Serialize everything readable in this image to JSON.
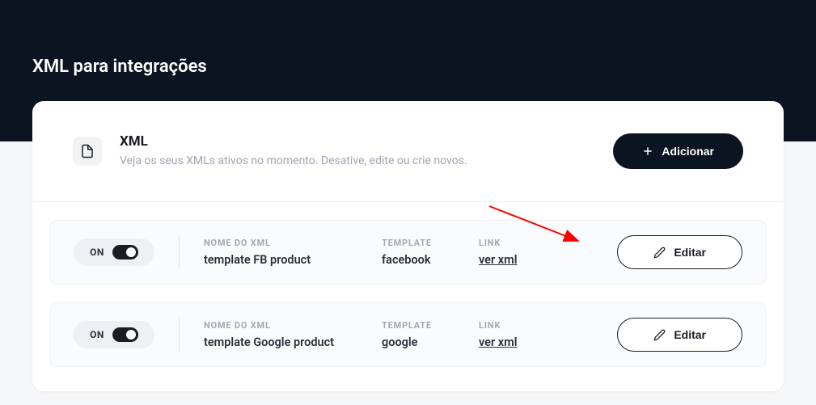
{
  "pageTitle": "XML para integrações",
  "section": {
    "title": "XML",
    "subtitle": "Veja os seus XMLs ativos no momento. Desative, edite ou crie novos.",
    "addLabel": "Adicionar"
  },
  "columns": {
    "name": "NOME DO XML",
    "template": "TEMPLATE",
    "link": "LINK"
  },
  "rows": [
    {
      "status": "ON",
      "name": "template FB product",
      "template": "facebook",
      "linkText": "ver xml",
      "editLabel": "Editar"
    },
    {
      "status": "ON",
      "name": "template Google product",
      "template": "google",
      "linkText": "ver xml",
      "editLabel": "Editar"
    }
  ]
}
